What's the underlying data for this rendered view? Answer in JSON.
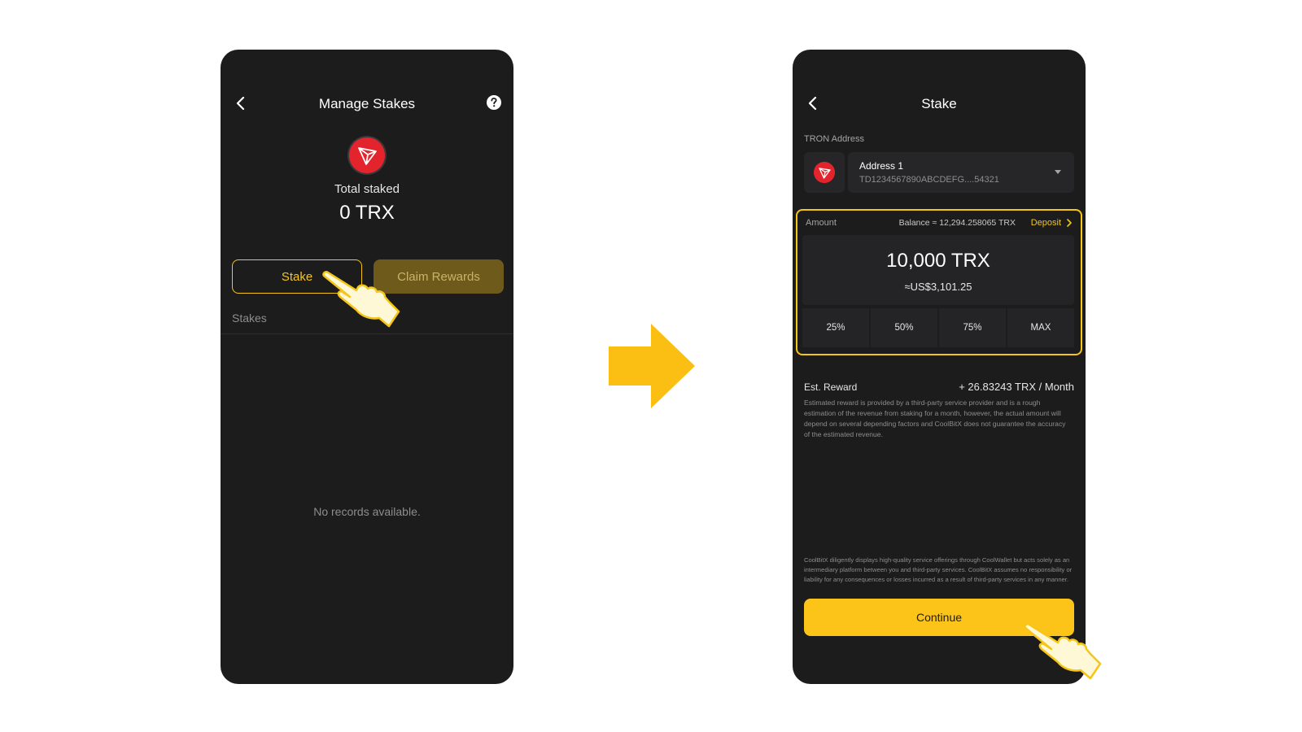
{
  "manage_stakes": {
    "title": "Manage Stakes",
    "total_staked_label": "Total staked",
    "total_staked_value": "0 TRX",
    "stake_button": "Stake",
    "claim_rewards_button": "Claim Rewards",
    "stakes_section_label": "Stakes",
    "empty_text": "No records available."
  },
  "stake": {
    "title": "Stake",
    "address_label": "TRON Address",
    "address_name": "Address 1",
    "address_value": "TD1234567890ABCDEFG....54321",
    "amount_label": "Amount",
    "balance_text": "Balance ≈ 12,294.258065 TRX",
    "deposit_link": "Deposit",
    "amount_value": "10,000 TRX",
    "amount_usd": "≈US$3,101.25",
    "percent_options": [
      "25%",
      "50%",
      "75%",
      "MAX"
    ],
    "est_reward_label": "Est. Reward",
    "est_reward_value": "+ 26.83243 TRX / Month",
    "est_reward_note": "Estimated reward is provided by a third-party service provider and is a rough estimation of the revenue from staking for a month, however, the actual amount will depend on several depending factors and CoolBitX does not guarantee the accuracy of the estimated revenue.",
    "disclaimer": "CoolBitX diligently displays high-quality service offerings through CoolWallet but acts solely as an intermediary platform between you and third-party services. CoolBitX assumes no responsibility or liability for any consequences or losses incurred as a result of third-party services in any manner.",
    "continue_button": "Continue"
  },
  "colors": {
    "accent": "#f5c518",
    "background": "#1c1c1d",
    "tron_red": "#e4242c"
  },
  "icons": [
    "back-icon",
    "help-icon",
    "tron-logo-icon",
    "chevron-down-icon",
    "chevron-right-icon",
    "arrow-right-icon",
    "pointing-hand-icon"
  ]
}
